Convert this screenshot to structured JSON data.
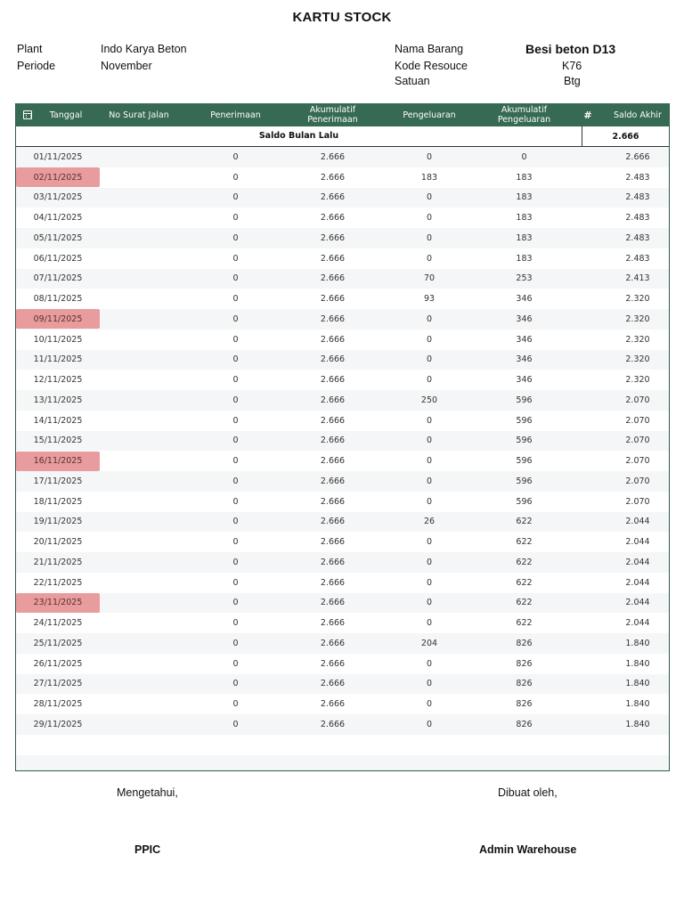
{
  "document": {
    "title": "KARTU STOCK"
  },
  "info": {
    "plant_label": "Plant",
    "plant_value": "Indo Karya Beton",
    "periode_label": "Periode",
    "periode_value": "November",
    "nama_barang_label": "Nama Barang",
    "nama_barang_value": "Besi beton D13",
    "kode_label": "Kode Resouce",
    "kode_value": "K76",
    "satuan_label": "Satuan",
    "satuan_value": "Btg"
  },
  "table": {
    "headers": {
      "icon": "calendar-icon",
      "tanggal": "Tanggal",
      "no_surat_jalan": "No Surat Jalan",
      "penerimaan": "Penerimaan",
      "akumulatif_penerimaan_1": "Akumulatif",
      "akumulatif_penerimaan_2": "Penerimaan",
      "pengeluaran": "Pengeluaran",
      "akumulatif_pengeluaran_1": "Akumulatif",
      "akumulatif_pengeluaran_2": "Pengeluaran",
      "hash": "#",
      "saldo_akhir": "Saldo Akhir"
    },
    "saldo_bulan_lalu_label": "Saldo Bulan Lalu",
    "saldo_bulan_lalu_value": "2.666",
    "highlight_color": "#e89c9d",
    "header_color": "#366a52",
    "rows": [
      {
        "tanggal": "01/11/2025",
        "sj": "",
        "pen": "0",
        "akp": "2.666",
        "peng": "0",
        "akg": "0",
        "saldo": "2.666",
        "hl": false
      },
      {
        "tanggal": "02/11/2025",
        "sj": "",
        "pen": "0",
        "akp": "2.666",
        "peng": "183",
        "akg": "183",
        "saldo": "2.483",
        "hl": true
      },
      {
        "tanggal": "03/11/2025",
        "sj": "",
        "pen": "0",
        "akp": "2.666",
        "peng": "0",
        "akg": "183",
        "saldo": "2.483",
        "hl": false
      },
      {
        "tanggal": "04/11/2025",
        "sj": "",
        "pen": "0",
        "akp": "2.666",
        "peng": "0",
        "akg": "183",
        "saldo": "2.483",
        "hl": false
      },
      {
        "tanggal": "05/11/2025",
        "sj": "",
        "pen": "0",
        "akp": "2.666",
        "peng": "0",
        "akg": "183",
        "saldo": "2.483",
        "hl": false
      },
      {
        "tanggal": "06/11/2025",
        "sj": "",
        "pen": "0",
        "akp": "2.666",
        "peng": "0",
        "akg": "183",
        "saldo": "2.483",
        "hl": false
      },
      {
        "tanggal": "07/11/2025",
        "sj": "",
        "pen": "0",
        "akp": "2.666",
        "peng": "70",
        "akg": "253",
        "saldo": "2.413",
        "hl": false
      },
      {
        "tanggal": "08/11/2025",
        "sj": "",
        "pen": "0",
        "akp": "2.666",
        "peng": "93",
        "akg": "346",
        "saldo": "2.320",
        "hl": false
      },
      {
        "tanggal": "09/11/2025",
        "sj": "",
        "pen": "0",
        "akp": "2.666",
        "peng": "0",
        "akg": "346",
        "saldo": "2.320",
        "hl": true
      },
      {
        "tanggal": "10/11/2025",
        "sj": "",
        "pen": "0",
        "akp": "2.666",
        "peng": "0",
        "akg": "346",
        "saldo": "2.320",
        "hl": false
      },
      {
        "tanggal": "11/11/2025",
        "sj": "",
        "pen": "0",
        "akp": "2.666",
        "peng": "0",
        "akg": "346",
        "saldo": "2.320",
        "hl": false
      },
      {
        "tanggal": "12/11/2025",
        "sj": "",
        "pen": "0",
        "akp": "2.666",
        "peng": "0",
        "akg": "346",
        "saldo": "2.320",
        "hl": false
      },
      {
        "tanggal": "13/11/2025",
        "sj": "",
        "pen": "0",
        "akp": "2.666",
        "peng": "250",
        "akg": "596",
        "saldo": "2.070",
        "hl": false
      },
      {
        "tanggal": "14/11/2025",
        "sj": "",
        "pen": "0",
        "akp": "2.666",
        "peng": "0",
        "akg": "596",
        "saldo": "2.070",
        "hl": false
      },
      {
        "tanggal": "15/11/2025",
        "sj": "",
        "pen": "0",
        "akp": "2.666",
        "peng": "0",
        "akg": "596",
        "saldo": "2.070",
        "hl": false
      },
      {
        "tanggal": "16/11/2025",
        "sj": "",
        "pen": "0",
        "akp": "2.666",
        "peng": "0",
        "akg": "596",
        "saldo": "2.070",
        "hl": true
      },
      {
        "tanggal": "17/11/2025",
        "sj": "",
        "pen": "0",
        "akp": "2.666",
        "peng": "0",
        "akg": "596",
        "saldo": "2.070",
        "hl": false
      },
      {
        "tanggal": "18/11/2025",
        "sj": "",
        "pen": "0",
        "akp": "2.666",
        "peng": "0",
        "akg": "596",
        "saldo": "2.070",
        "hl": false
      },
      {
        "tanggal": "19/11/2025",
        "sj": "",
        "pen": "0",
        "akp": "2.666",
        "peng": "26",
        "akg": "622",
        "saldo": "2.044",
        "hl": false
      },
      {
        "tanggal": "20/11/2025",
        "sj": "",
        "pen": "0",
        "akp": "2.666",
        "peng": "0",
        "akg": "622",
        "saldo": "2.044",
        "hl": false
      },
      {
        "tanggal": "21/11/2025",
        "sj": "",
        "pen": "0",
        "akp": "2.666",
        "peng": "0",
        "akg": "622",
        "saldo": "2.044",
        "hl": false
      },
      {
        "tanggal": "22/11/2025",
        "sj": "",
        "pen": "0",
        "akp": "2.666",
        "peng": "0",
        "akg": "622",
        "saldo": "2.044",
        "hl": false
      },
      {
        "tanggal": "23/11/2025",
        "sj": "",
        "pen": "0",
        "akp": "2.666",
        "peng": "0",
        "akg": "622",
        "saldo": "2.044",
        "hl": true
      },
      {
        "tanggal": "24/11/2025",
        "sj": "",
        "pen": "0",
        "akp": "2.666",
        "peng": "0",
        "akg": "622",
        "saldo": "2.044",
        "hl": false
      },
      {
        "tanggal": "25/11/2025",
        "sj": "",
        "pen": "0",
        "akp": "2.666",
        "peng": "204",
        "akg": "826",
        "saldo": "1.840",
        "hl": false
      },
      {
        "tanggal": "26/11/2025",
        "sj": "",
        "pen": "0",
        "akp": "2.666",
        "peng": "0",
        "akg": "826",
        "saldo": "1.840",
        "hl": false
      },
      {
        "tanggal": "27/11/2025",
        "sj": "",
        "pen": "0",
        "akp": "2.666",
        "peng": "0",
        "akg": "826",
        "saldo": "1.840",
        "hl": false
      },
      {
        "tanggal": "28/11/2025",
        "sj": "",
        "pen": "0",
        "akp": "2.666",
        "peng": "0",
        "akg": "826",
        "saldo": "1.840",
        "hl": false
      },
      {
        "tanggal": "29/11/2025",
        "sj": "",
        "pen": "0",
        "akp": "2.666",
        "peng": "0",
        "akg": "826",
        "saldo": "1.840",
        "hl": false
      }
    ],
    "empty_rows": 2
  },
  "signatures": {
    "left_caption": "Mengetahui,",
    "left_role": "PPIC",
    "right_caption": "Dibuat oleh,",
    "right_role": "Admin Warehouse"
  }
}
